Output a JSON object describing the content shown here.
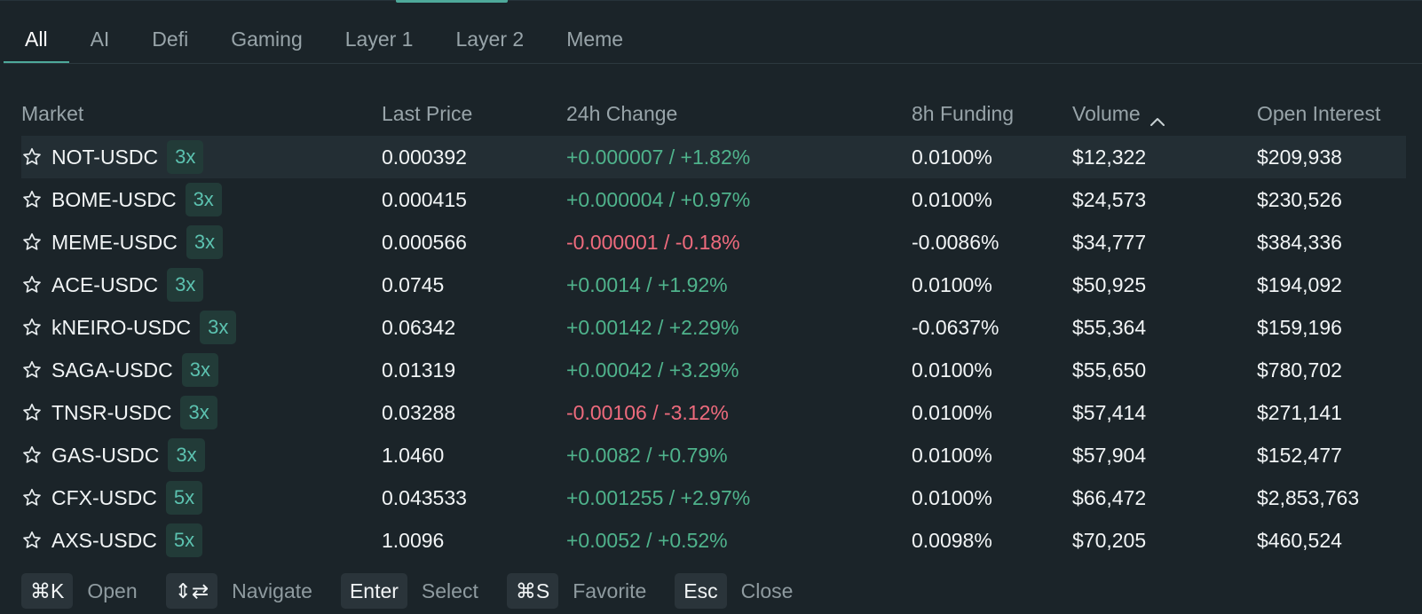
{
  "tabs": [
    {
      "label": "All",
      "active": true
    },
    {
      "label": "AI",
      "active": false
    },
    {
      "label": "Defi",
      "active": false
    },
    {
      "label": "Gaming",
      "active": false
    },
    {
      "label": "Layer 1",
      "active": false
    },
    {
      "label": "Layer 2",
      "active": false
    },
    {
      "label": "Meme",
      "active": false
    }
  ],
  "columns": {
    "market": "Market",
    "last_price": "Last Price",
    "change_24h": "24h Change",
    "funding_8h": "8h Funding",
    "volume": "Volume",
    "open_interest": "Open Interest",
    "sort_icon": "chevron-up-icon"
  },
  "rows": [
    {
      "market": "NOT-USDC",
      "leverage": "3x",
      "last_price": "0.000392",
      "change": "+0.000007 / +1.82%",
      "direction": "up",
      "funding": "0.0100%",
      "volume": "$12,322",
      "open_interest": "$209,938"
    },
    {
      "market": "BOME-USDC",
      "leverage": "3x",
      "last_price": "0.000415",
      "change": "+0.000004 / +0.97%",
      "direction": "up",
      "funding": "0.0100%",
      "volume": "$24,573",
      "open_interest": "$230,526"
    },
    {
      "market": "MEME-USDC",
      "leverage": "3x",
      "last_price": "0.000566",
      "change": "-0.000001 / -0.18%",
      "direction": "down",
      "funding": "-0.0086%",
      "volume": "$34,777",
      "open_interest": "$384,336"
    },
    {
      "market": "ACE-USDC",
      "leverage": "3x",
      "last_price": "0.0745",
      "change": "+0.0014 / +1.92%",
      "direction": "up",
      "funding": "0.0100%",
      "volume": "$50,925",
      "open_interest": "$194,092"
    },
    {
      "market": "kNEIRO-USDC",
      "leverage": "3x",
      "last_price": "0.06342",
      "change": "+0.00142 / +2.29%",
      "direction": "up",
      "funding": "-0.0637%",
      "volume": "$55,364",
      "open_interest": "$159,196"
    },
    {
      "market": "SAGA-USDC",
      "leverage": "3x",
      "last_price": "0.01319",
      "change": "+0.00042 / +3.29%",
      "direction": "up",
      "funding": "0.0100%",
      "volume": "$55,650",
      "open_interest": "$780,702"
    },
    {
      "market": "TNSR-USDC",
      "leverage": "3x",
      "last_price": "0.03288",
      "change": "-0.00106 / -3.12%",
      "direction": "down",
      "funding": "0.0100%",
      "volume": "$57,414",
      "open_interest": "$271,141"
    },
    {
      "market": "GAS-USDC",
      "leverage": "3x",
      "last_price": "1.0460",
      "change": "+0.0082 / +0.79%",
      "direction": "up",
      "funding": "0.0100%",
      "volume": "$57,904",
      "open_interest": "$152,477"
    },
    {
      "market": "CFX-USDC",
      "leverage": "5x",
      "last_price": "0.043533",
      "change": "+0.001255 / +2.97%",
      "direction": "up",
      "funding": "0.0100%",
      "volume": "$66,472",
      "open_interest": "$2,853,763"
    },
    {
      "market": "AXS-USDC",
      "leverage": "5x",
      "last_price": "1.0096",
      "change": "+0.0052 / +0.52%",
      "direction": "up",
      "funding": "0.0098%",
      "volume": "$70,205",
      "open_interest": "$460,524"
    }
  ],
  "footer": [
    {
      "key": "⌘K",
      "label": "Open"
    },
    {
      "key": "⇕⇄",
      "label": "Navigate"
    },
    {
      "key": "Enter",
      "label": "Select"
    },
    {
      "key": "⌘S",
      "label": "Favorite"
    },
    {
      "key": "Esc",
      "label": "Close"
    }
  ],
  "colors": {
    "background": "#1b2429",
    "accent": "#4ea99a",
    "positive": "#4fb38c",
    "negative": "#ee6b7d",
    "leverage_bg": "#223b38",
    "leverage_text": "#5cc2b0"
  },
  "icons": {
    "favorite": "star-outline-icon"
  }
}
